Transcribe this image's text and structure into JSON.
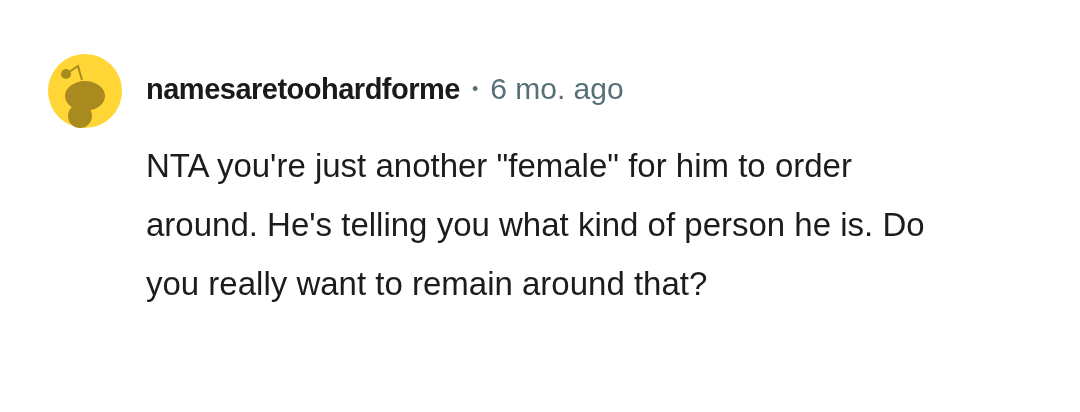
{
  "comment": {
    "author": "namesaretoohardforme",
    "separator": "•",
    "time": "6 mo. ago",
    "body": "NTA you're just another \"female\" for him to order around. He's telling you what kind of person he is. Do you really want to remain around that?"
  }
}
